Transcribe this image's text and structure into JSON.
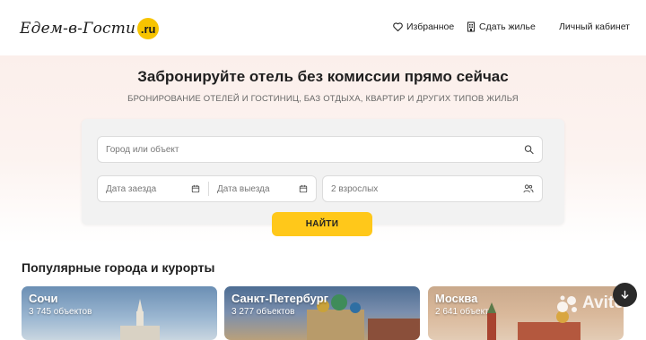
{
  "header": {
    "logo_text": "Едем-в-Гости",
    "logo_badge": ".ru",
    "nav": {
      "favorites": "Избранное",
      "rent_out": "Сдать жилье",
      "account": "Личный кабинет"
    }
  },
  "hero": {
    "title": "Забронируйте отель без комиссии прямо сейчас",
    "subtitle": "БРОНИРОВАНИЕ ОТЕЛЕЙ И ГОСТИНИЦ, БАЗ ОТДЫХА, КВАРТИР И ДРУГИХ ТИПОВ ЖИЛЬЯ"
  },
  "search": {
    "city_placeholder": "Город или объект",
    "checkin_placeholder": "Дата заезда",
    "checkout_placeholder": "Дата выезда",
    "guests": "2 взрослых",
    "find_label": "НАЙТИ"
  },
  "popular": {
    "title": "Популярные города и курорты",
    "cities": [
      {
        "name": "Сочи",
        "count": "3 745 объектов"
      },
      {
        "name": "Санкт-Петербург",
        "count": "3 277 объектов"
      },
      {
        "name": "Москва",
        "count": "2 641 объект"
      }
    ]
  },
  "watermark": "Avito",
  "colors": {
    "accent": "#ffc81a",
    "hero_bg": "#fbefeb",
    "search_panel": "#f2f2f2"
  },
  "icons": [
    "heart-icon",
    "building-icon",
    "search-icon",
    "calendar-icon",
    "guests-icon",
    "arrow-down-icon",
    "avito-logo-icon"
  ]
}
